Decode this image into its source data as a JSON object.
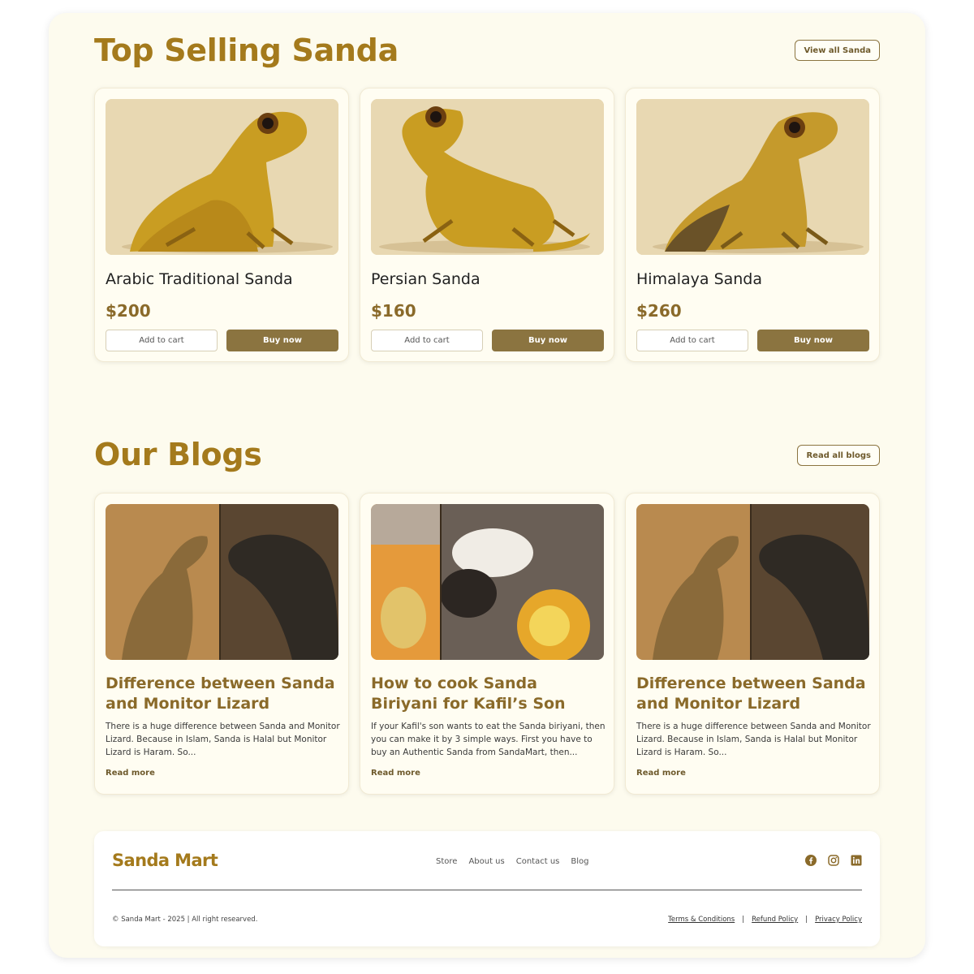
{
  "products_section": {
    "title": "Top Selling Sanda",
    "view_all_label": "View all Sanda",
    "items": [
      {
        "name": "Arabic Traditional Sanda",
        "price": "$200",
        "add_to_cart": "Add to cart",
        "buy_now": "Buy now"
      },
      {
        "name": "Persian Sanda",
        "price": "$160",
        "add_to_cart": "Add to cart",
        "buy_now": "Buy now"
      },
      {
        "name": "Himalaya Sanda",
        "price": "$260",
        "add_to_cart": "Add to cart",
        "buy_now": "Buy now"
      }
    ]
  },
  "blogs_section": {
    "title": "Our Blogs",
    "read_all_label": "Read all blogs",
    "items": [
      {
        "title": "Difference between Sanda and Monitor Lizard",
        "excerpt": "There is a huge difference between Sanda and Monitor Lizard. Because in Islam, Sanda is Halal but Monitor Lizard is Haram. So...",
        "read_more": "Read more"
      },
      {
        "title": "How to cook Sanda Biriyani for Kafil’s Son",
        "excerpt": "If your Kafil's son wants to eat the Sanda biriyani, then you can make it by 3 simple ways. First you have to buy an Authentic Sanda from SandaMart, then...",
        "read_more": "Read more"
      },
      {
        "title": "Difference between Sanda and Monitor Lizard",
        "excerpt": "There is a huge difference between Sanda and Monitor Lizard. Because in Islam, Sanda is Halal but Monitor Lizard is Haram. So...",
        "read_more": "Read more"
      }
    ]
  },
  "footer": {
    "brand": "Sanda Mart",
    "nav": [
      "Store",
      "About us",
      "Contact us",
      "Blog"
    ],
    "social_icons": [
      "facebook-icon",
      "instagram-icon",
      "linkedin-icon"
    ],
    "copyright": "© Sanda Mart - 2025 | All right researved.",
    "legal": [
      "Terms & Conditions",
      "Refund Policy",
      "Privacy Policy"
    ]
  },
  "colors": {
    "page_background": "#fdfbee",
    "heading": "#a47a1c",
    "primary_button": "#8b7440",
    "price": "#8a6a2a"
  }
}
